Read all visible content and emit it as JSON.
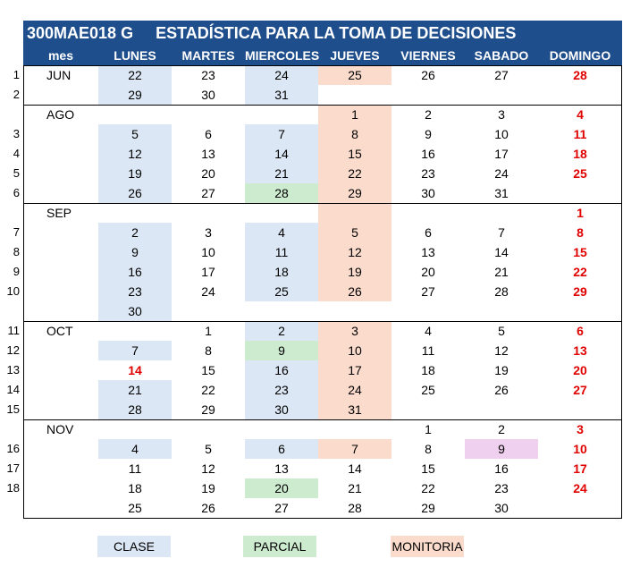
{
  "title": "300MAE018 G     ESTADÍSTICA PARA LA TOMA DE DECISIONES",
  "headers": [
    "mes",
    "LUNES",
    "MARTES",
    "MIERCOLES",
    "JUEVES",
    "VIERNES",
    "SABADO",
    "DOMINGO"
  ],
  "colors": {
    "header": "#1f4e8c",
    "clase": "#dbe7f4",
    "parcial": "#cdeccf",
    "monitoria": "#fadbcc",
    "pink": "#f0d0ef",
    "sunday": "#e00000"
  },
  "rows": [
    {
      "num": "1",
      "mes": "JUN",
      "d": [
        "22",
        "23",
        "24",
        "25",
        "26",
        "27",
        "28"
      ],
      "c": [
        "clase",
        "",
        "clase",
        "monitoria",
        "",
        "",
        ""
      ],
      "r": [
        0,
        0,
        0,
        0,
        0,
        0,
        1
      ]
    },
    {
      "num": "2",
      "mes": "",
      "d": [
        "29",
        "30",
        "31",
        "",
        "",
        "",
        ""
      ],
      "c": [
        "clase",
        "",
        "clase",
        "",
        "",
        "",
        ""
      ],
      "r": [
        0,
        0,
        0,
        0,
        0,
        0,
        0
      ]
    },
    {
      "num": "",
      "mes": "AGO",
      "d": [
        "",
        "",
        "",
        "1",
        "2",
        "3",
        "4"
      ],
      "c": [
        "",
        "",
        "",
        "monitoria",
        "",
        "",
        ""
      ],
      "r": [
        0,
        0,
        0,
        0,
        0,
        0,
        1
      ]
    },
    {
      "num": "3",
      "mes": "",
      "d": [
        "5",
        "6",
        "7",
        "8",
        "9",
        "10",
        "11"
      ],
      "c": [
        "clase",
        "",
        "clase",
        "monitoria",
        "",
        "",
        ""
      ],
      "r": [
        0,
        0,
        0,
        0,
        0,
        0,
        1
      ]
    },
    {
      "num": "4",
      "mes": "",
      "d": [
        "12",
        "13",
        "14",
        "15",
        "16",
        "17",
        "18"
      ],
      "c": [
        "clase",
        "",
        "clase",
        "monitoria",
        "",
        "",
        ""
      ],
      "r": [
        0,
        0,
        0,
        0,
        0,
        0,
        1
      ]
    },
    {
      "num": "5",
      "mes": "",
      "d": [
        "19",
        "20",
        "21",
        "22",
        "23",
        "24",
        "25"
      ],
      "c": [
        "clase",
        "",
        "clase",
        "monitoria",
        "",
        "",
        ""
      ],
      "r": [
        0,
        0,
        0,
        0,
        0,
        0,
        1
      ]
    },
    {
      "num": "6",
      "mes": "",
      "d": [
        "26",
        "27",
        "28",
        "29",
        "30",
        "31",
        ""
      ],
      "c": [
        "clase",
        "",
        "parcial",
        "monitoria",
        "",
        "",
        ""
      ],
      "r": [
        0,
        0,
        0,
        0,
        0,
        0,
        0
      ]
    },
    {
      "num": "",
      "mes": "SEP",
      "d": [
        "",
        "",
        "",
        "",
        "",
        "",
        "1"
      ],
      "c": [
        "",
        "",
        "",
        "monitoria",
        "",
        "",
        ""
      ],
      "r": [
        0,
        0,
        0,
        0,
        0,
        0,
        1
      ]
    },
    {
      "num": "7",
      "mes": "",
      "d": [
        "2",
        "3",
        "4",
        "5",
        "6",
        "7",
        "8"
      ],
      "c": [
        "clase",
        "",
        "clase",
        "monitoria",
        "",
        "",
        ""
      ],
      "r": [
        0,
        0,
        0,
        0,
        0,
        0,
        1
      ]
    },
    {
      "num": "8",
      "mes": "",
      "d": [
        "9",
        "10",
        "11",
        "12",
        "13",
        "14",
        "15"
      ],
      "c": [
        "clase",
        "",
        "clase",
        "monitoria",
        "",
        "",
        ""
      ],
      "r": [
        0,
        0,
        0,
        0,
        0,
        0,
        1
      ]
    },
    {
      "num": "9",
      "mes": "",
      "d": [
        "16",
        "17",
        "18",
        "19",
        "20",
        "21",
        "22"
      ],
      "c": [
        "clase",
        "",
        "clase",
        "monitoria",
        "",
        "",
        ""
      ],
      "r": [
        0,
        0,
        0,
        0,
        0,
        0,
        1
      ]
    },
    {
      "num": "10",
      "mes": "",
      "d": [
        "23",
        "24",
        "25",
        "26",
        "27",
        "28",
        "29"
      ],
      "c": [
        "clase",
        "",
        "clase",
        "monitoria",
        "",
        "",
        ""
      ],
      "r": [
        0,
        0,
        0,
        0,
        0,
        0,
        1
      ]
    },
    {
      "num": "",
      "mes": "",
      "d": [
        "30",
        "",
        "",
        "",
        "",
        "",
        ""
      ],
      "c": [
        "clase",
        "",
        "",
        "",
        "",
        "",
        ""
      ],
      "r": [
        0,
        0,
        0,
        0,
        0,
        0,
        0
      ]
    },
    {
      "num": "11",
      "mes": "OCT",
      "d": [
        "",
        "1",
        "2",
        "3",
        "4",
        "5",
        "6"
      ],
      "c": [
        "",
        "",
        "clase",
        "monitoria",
        "",
        "",
        ""
      ],
      "r": [
        0,
        0,
        0,
        0,
        0,
        0,
        1
      ]
    },
    {
      "num": "12",
      "mes": "",
      "d": [
        "7",
        "8",
        "9",
        "10",
        "11",
        "12",
        "13"
      ],
      "c": [
        "clase",
        "",
        "parcial",
        "monitoria",
        "",
        "",
        ""
      ],
      "r": [
        0,
        0,
        0,
        0,
        0,
        0,
        1
      ]
    },
    {
      "num": "13",
      "mes": "",
      "d": [
        "14",
        "15",
        "16",
        "17",
        "18",
        "19",
        "20"
      ],
      "c": [
        "",
        "",
        "clase",
        "monitoria",
        "",
        "",
        ""
      ],
      "r": [
        1,
        0,
        0,
        0,
        0,
        0,
        1
      ]
    },
    {
      "num": "14",
      "mes": "",
      "d": [
        "21",
        "22",
        "23",
        "24",
        "25",
        "26",
        "27"
      ],
      "c": [
        "clase",
        "",
        "clase",
        "monitoria",
        "",
        "",
        ""
      ],
      "r": [
        0,
        0,
        0,
        0,
        0,
        0,
        1
      ]
    },
    {
      "num": "15",
      "mes": "",
      "d": [
        "28",
        "29",
        "30",
        "31",
        "",
        "",
        ""
      ],
      "c": [
        "clase",
        "",
        "clase",
        "monitoria",
        "",
        "",
        ""
      ],
      "r": [
        0,
        0,
        0,
        0,
        0,
        0,
        0
      ]
    },
    {
      "num": "",
      "mes": "NOV",
      "d": [
        "",
        "",
        "",
        "",
        "1",
        "2",
        "3"
      ],
      "c": [
        "",
        "",
        "",
        "",
        "",
        "",
        ""
      ],
      "r": [
        0,
        0,
        0,
        0,
        0,
        0,
        1
      ]
    },
    {
      "num": "16",
      "mes": "",
      "d": [
        "4",
        "5",
        "6",
        "7",
        "8",
        "9",
        "10"
      ],
      "c": [
        "clase",
        "",
        "clase",
        "monitoria",
        "",
        "pink",
        ""
      ],
      "r": [
        0,
        0,
        0,
        0,
        0,
        0,
        1
      ]
    },
    {
      "num": "17",
      "mes": "",
      "d": [
        "11",
        "12",
        "13",
        "14",
        "15",
        "16",
        "17"
      ],
      "c": [
        "",
        "",
        "",
        "",
        "",
        "",
        ""
      ],
      "r": [
        0,
        0,
        0,
        0,
        0,
        0,
        1
      ]
    },
    {
      "num": "18",
      "mes": "",
      "d": [
        "18",
        "19",
        "20",
        "21",
        "22",
        "23",
        "24"
      ],
      "c": [
        "",
        "",
        "parcial",
        "",
        "",
        "",
        ""
      ],
      "r": [
        0,
        0,
        0,
        0,
        0,
        0,
        1
      ]
    },
    {
      "num": "",
      "mes": "",
      "d": [
        "25",
        "26",
        "27",
        "28",
        "29",
        "30",
        ""
      ],
      "c": [
        "",
        "",
        "",
        "",
        "",
        "",
        ""
      ],
      "r": [
        0,
        0,
        0,
        0,
        0,
        0,
        0
      ]
    }
  ],
  "legend": [
    {
      "label": "CLASE",
      "kind": "clase"
    },
    {
      "label": "PARCIAL",
      "kind": "parcial"
    },
    {
      "label": "MONITORIA",
      "kind": "monitoria"
    }
  ]
}
